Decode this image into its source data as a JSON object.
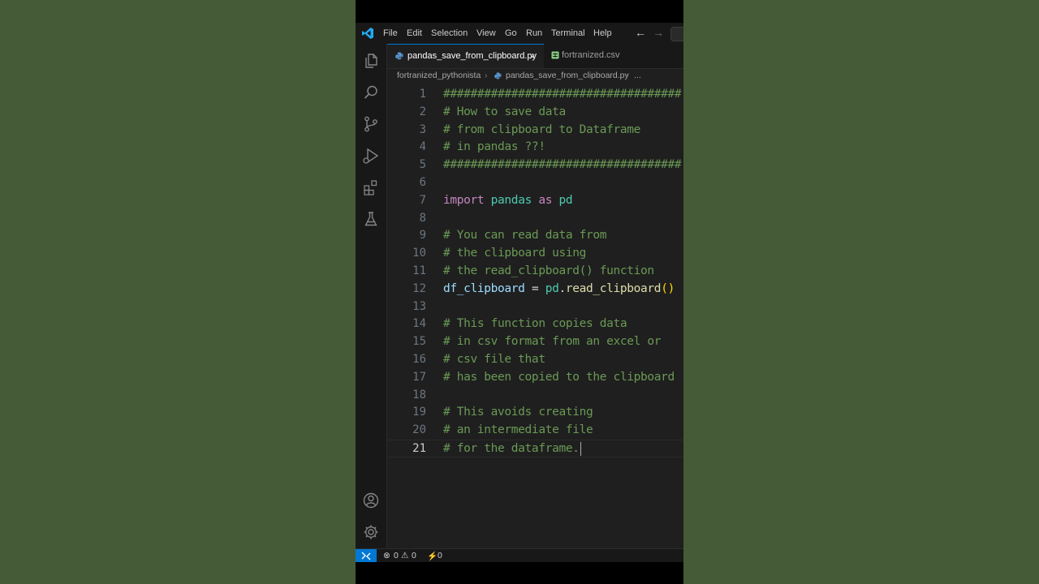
{
  "menu": [
    "File",
    "Edit",
    "Selection",
    "View",
    "Go",
    "Run",
    "Terminal",
    "Help"
  ],
  "tabs": [
    {
      "label": "pandas_save_from_clipboard.py",
      "active": true,
      "close": "×"
    },
    {
      "label": "fortranized.csv",
      "active": false
    }
  ],
  "breadcrumb": {
    "folder": "fortranized_pythonista",
    "file": "pandas_save_from_clipboard.py",
    "more": "..."
  },
  "editor": {
    "current_line": 21,
    "lines": [
      {
        "n": "1",
        "tokens": [
          {
            "c": "cmt",
            "t": "###################################"
          }
        ]
      },
      {
        "n": "2",
        "tokens": [
          {
            "c": "cmt",
            "t": "# How to save data"
          }
        ]
      },
      {
        "n": "3",
        "tokens": [
          {
            "c": "cmt",
            "t": "# from clipboard to Dataframe"
          }
        ]
      },
      {
        "n": "4",
        "tokens": [
          {
            "c": "cmt",
            "t": "# in pandas ??!"
          }
        ]
      },
      {
        "n": "5",
        "tokens": [
          {
            "c": "cmt",
            "t": "###################################"
          }
        ]
      },
      {
        "n": "6",
        "tokens": []
      },
      {
        "n": "7",
        "tokens": [
          {
            "c": "kw",
            "t": "import"
          },
          {
            "c": "pl",
            "t": " "
          },
          {
            "c": "mod",
            "t": "pandas"
          },
          {
            "c": "pl",
            "t": " "
          },
          {
            "c": "kw",
            "t": "as"
          },
          {
            "c": "pl",
            "t": " "
          },
          {
            "c": "mod",
            "t": "pd"
          }
        ]
      },
      {
        "n": "8",
        "tokens": []
      },
      {
        "n": "9",
        "tokens": [
          {
            "c": "cmt",
            "t": "# You can read data from"
          }
        ]
      },
      {
        "n": "10",
        "tokens": [
          {
            "c": "cmt",
            "t": "# the clipboard using"
          }
        ]
      },
      {
        "n": "11",
        "tokens": [
          {
            "c": "cmt",
            "t": "# the read_clipboard() function"
          }
        ]
      },
      {
        "n": "12",
        "tokens": [
          {
            "c": "var",
            "t": "df_clipboard"
          },
          {
            "c": "pl",
            "t": " = "
          },
          {
            "c": "mod",
            "t": "pd"
          },
          {
            "c": "pl",
            "t": "."
          },
          {
            "c": "fn",
            "t": "read_clipboard"
          },
          {
            "c": "paren",
            "t": "()"
          }
        ]
      },
      {
        "n": "13",
        "tokens": []
      },
      {
        "n": "14",
        "tokens": [
          {
            "c": "cmt",
            "t": "# This function copies data"
          }
        ]
      },
      {
        "n": "15",
        "tokens": [
          {
            "c": "cmt",
            "t": "# in csv format from an excel or"
          }
        ]
      },
      {
        "n": "16",
        "tokens": [
          {
            "c": "cmt",
            "t": "# csv file that"
          }
        ]
      },
      {
        "n": "17",
        "tokens": [
          {
            "c": "cmt",
            "t": "# has been copied to the clipboard"
          }
        ]
      },
      {
        "n": "18",
        "tokens": []
      },
      {
        "n": "19",
        "tokens": [
          {
            "c": "cmt",
            "t": "# This avoids creating"
          }
        ]
      },
      {
        "n": "20",
        "tokens": [
          {
            "c": "cmt",
            "t": "# an intermediate file"
          }
        ]
      },
      {
        "n": "21",
        "tokens": [
          {
            "c": "cmt",
            "t": "# for the dataframe."
          }
        ]
      }
    ]
  },
  "statusbar": {
    "errors": "0",
    "warnings": "0",
    "ports": "0"
  },
  "colors": {
    "accent": "#0078d4",
    "comment": "#6a9955",
    "keyword": "#c586c0",
    "module": "#4ec9b0",
    "variable": "#9cdcfe",
    "function": "#dcdcaa",
    "background_green": "#455b38"
  },
  "icons": {
    "activity": [
      "explorer-icon",
      "search-icon",
      "source-control-icon",
      "run-debug-icon",
      "extensions-icon",
      "testing-icon"
    ],
    "bottom": [
      "account-icon",
      "settings-gear-icon"
    ]
  }
}
